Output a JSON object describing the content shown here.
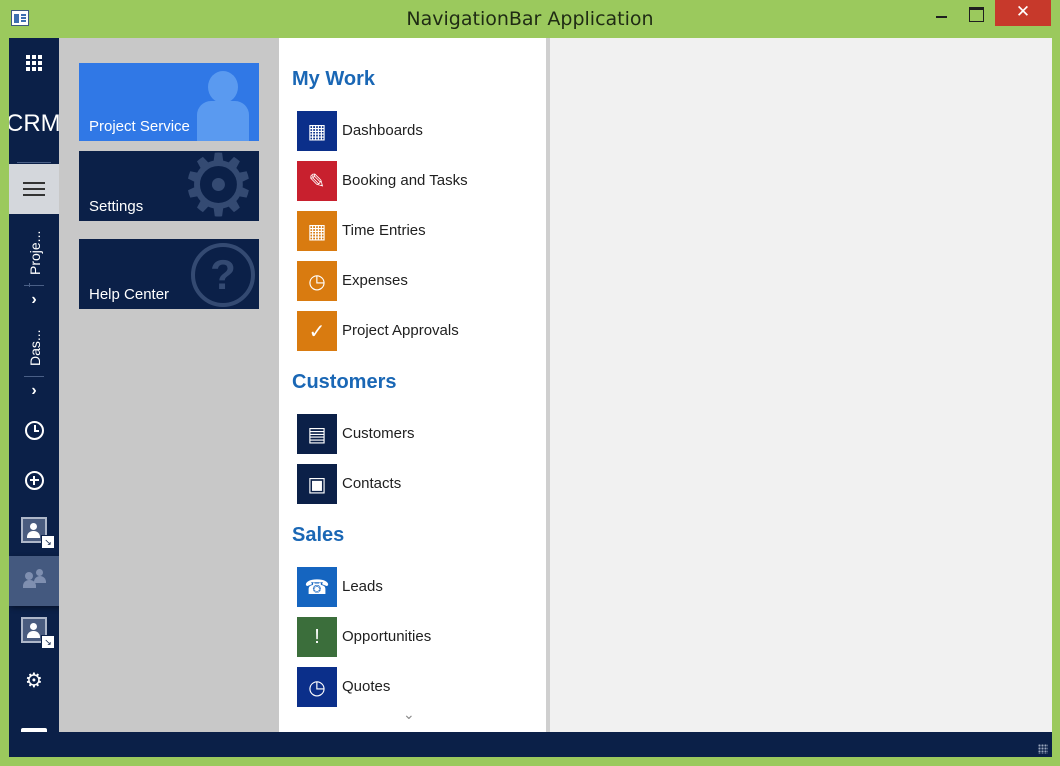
{
  "window": {
    "title": "NavigationBar Application",
    "close_glyph": "✕"
  },
  "strip": {
    "brand": "CRM",
    "breadcrumb_1": "Proje...",
    "breadcrumb_2": "Das...",
    "chevron": "›",
    "gear_glyph": "⚙"
  },
  "flyout": {
    "search_value": ""
  },
  "tiles": [
    {
      "label": "Project Service",
      "icon": "person-icon",
      "color": "#3078e6"
    },
    {
      "label": "Settings",
      "icon": "gear-icon",
      "color": "#0b2048"
    },
    {
      "label": "Help Center",
      "icon": "help-icon",
      "color": "#0b2048"
    }
  ],
  "tile_glyphs": {
    "gear": "⚙",
    "help": "?"
  },
  "menu": {
    "groups": [
      {
        "title": "My Work",
        "items": [
          {
            "label": "Dashboards",
            "icon": "dashboard-icon",
            "color": "#0b2f8a"
          },
          {
            "label": "Booking and Tasks",
            "icon": "clipboard-edit-icon",
            "color": "#c8202e"
          },
          {
            "label": "Time Entries",
            "icon": "calendar-icon",
            "color": "#d97b10"
          },
          {
            "label": "Expenses",
            "icon": "receipt-clock-icon",
            "color": "#d97b10"
          },
          {
            "label": "Project Approvals",
            "icon": "document-check-icon",
            "color": "#d97b10"
          }
        ]
      },
      {
        "title": "Customers",
        "items": [
          {
            "label": "Customers",
            "icon": "customer-card-icon",
            "color": "#0b2048"
          },
          {
            "label": "Contacts",
            "icon": "contact-card-icon",
            "color": "#0b2048"
          }
        ]
      },
      {
        "title": "Sales",
        "items": [
          {
            "label": "Leads",
            "icon": "phone-alert-icon",
            "color": "#1565c0"
          },
          {
            "label": "Opportunities",
            "icon": "folder-alert-icon",
            "color": "#3b6e3b"
          },
          {
            "label": "Quotes",
            "icon": "quote-clock-icon",
            "color": "#0b2f8a"
          }
        ]
      }
    ],
    "scroll_glyph": "⌄"
  },
  "glyphs": {
    "dashboard-icon": "▦",
    "clipboard-edit-icon": "✎",
    "calendar-icon": "▦",
    "receipt-clock-icon": "◷",
    "document-check-icon": "✓",
    "customer-card-icon": "▤",
    "contact-card-icon": "▣",
    "phone-alert-icon": "☎",
    "folder-alert-icon": "!",
    "quote-clock-icon": "◷"
  }
}
